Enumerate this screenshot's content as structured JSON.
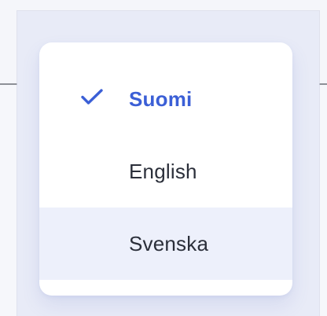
{
  "menu": {
    "items": [
      {
        "label": "Suomi",
        "selected": true,
        "hovered": false
      },
      {
        "label": "English",
        "selected": false,
        "hovered": false
      },
      {
        "label": "Svenska",
        "selected": false,
        "hovered": true
      }
    ]
  },
  "icons": {
    "selected_indicator": "check-icon"
  },
  "colors": {
    "accent": "#3b5fd6",
    "text": "#2b2f3a",
    "hover_bg": "#edf0fb",
    "overlay_bg": "#e8ebf7",
    "menu_bg": "#ffffff",
    "page_bg": "#f5f6fa",
    "divider": "#8d9097"
  }
}
